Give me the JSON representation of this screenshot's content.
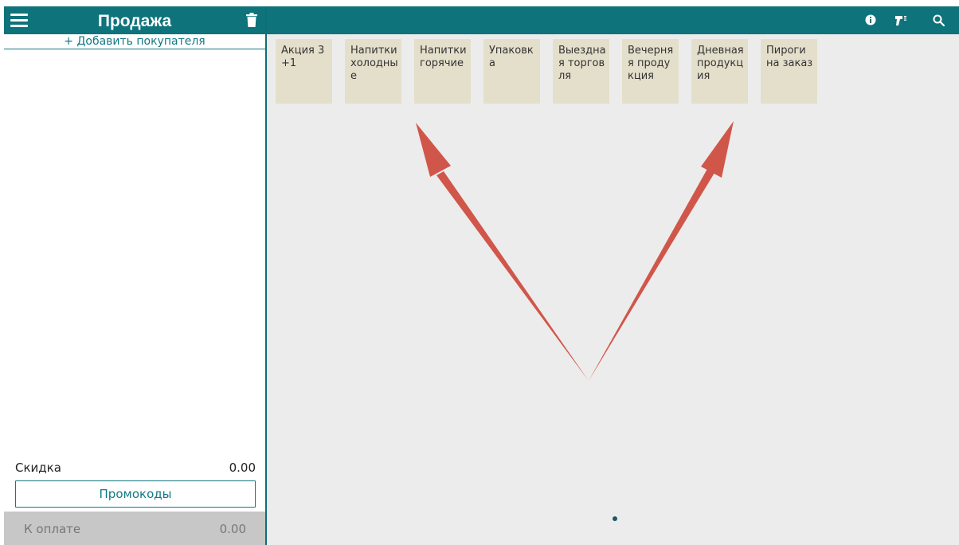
{
  "left_panel": {
    "title": "Продажа",
    "add_customer": "+ Добавить покупателя",
    "discount": {
      "label": "Скидка",
      "value": "0.00"
    },
    "promo_button": "Промокоды",
    "payment": {
      "label": "К оплате",
      "value": "0.00"
    }
  },
  "topbar": {
    "icons": [
      "info-icon",
      "barcode-scanner-icon",
      "search-icon"
    ]
  },
  "categories": [
    {
      "label": "Акция 3+1"
    },
    {
      "label": "Напитки холодные"
    },
    {
      "label": "Напитки горячие"
    },
    {
      "label": "Упаковка"
    },
    {
      "label": "Выездная торговля"
    },
    {
      "label": "Вечерняя продукция"
    },
    {
      "label": "Дневная продукция"
    },
    {
      "label": "Пироги на заказ"
    }
  ],
  "colors": {
    "header": "#0e737b",
    "category_tile": "#e4dfcb",
    "annotation_arrow": "#d1564a",
    "workspace": "#ececec"
  }
}
